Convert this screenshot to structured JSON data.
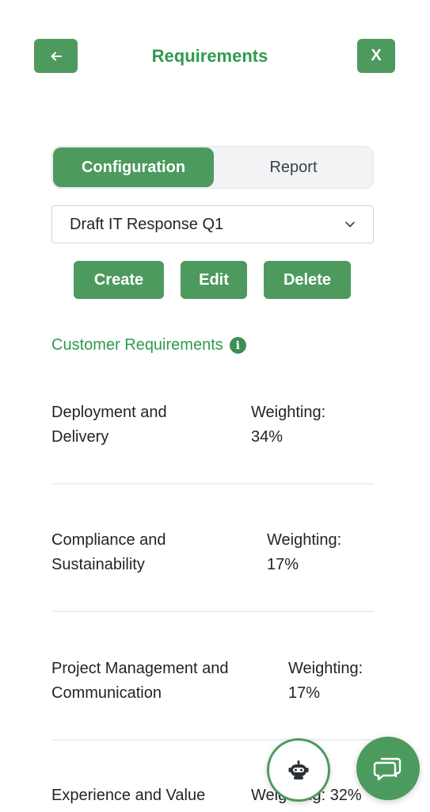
{
  "header": {
    "title": "Requirements",
    "back_icon": "arrow-left-icon",
    "close_label": "X"
  },
  "tabs": {
    "active": "Configuration",
    "inactive": "Report"
  },
  "dropdown": {
    "selected": "Draft IT Response Q1",
    "icon": "chevron-down-icon"
  },
  "actions": {
    "create": "Create",
    "edit": "Edit",
    "delete": "Delete"
  },
  "section": {
    "title": "Customer Requirements",
    "info_glyph": "i"
  },
  "requirements": [
    {
      "name_line1": "Deployment and",
      "name_line2": "Delivery",
      "weight_label": "Weighting:",
      "weight_value": "34%"
    },
    {
      "name_line1": "Compliance and",
      "name_line2": "Sustainability",
      "weight_label": "Weighting:",
      "weight_value": "17%"
    },
    {
      "name_line1": "Project Management and",
      "name_line2": "Communication",
      "weight_label": "Weighting:",
      "weight_value": "17%"
    },
    {
      "name_line1": "Experience and Value",
      "name_line2": "",
      "weight_label": "Weighting: 32%",
      "weight_value": ""
    }
  ],
  "colors": {
    "accent": "#4d9a5e",
    "accent_text": "#2f9a50"
  },
  "floating": {
    "bot_icon": "robot-icon",
    "chat_icon": "chat-bubbles-icon"
  }
}
